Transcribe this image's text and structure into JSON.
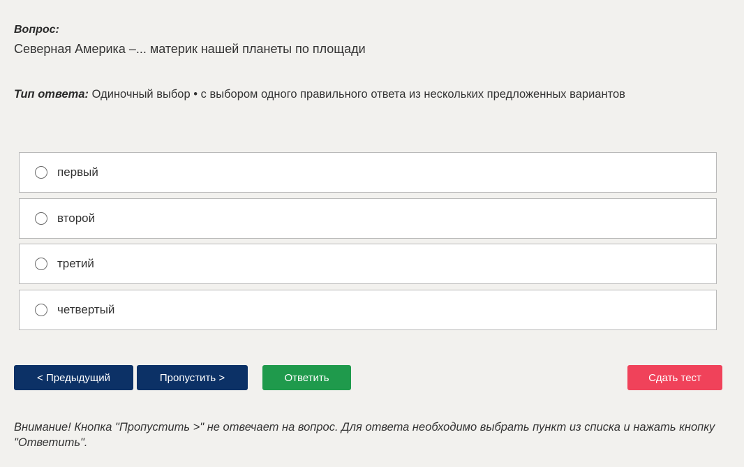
{
  "question": {
    "label": "Вопрос:",
    "text": "Северная Америка –... материк нашей планеты по площади"
  },
  "answer_type": {
    "label": "Тип ответа:",
    "value": "Одиночный выбор • с выбором одного правильного ответа из нескольких предложенных вариантов"
  },
  "options": [
    {
      "label": "первый",
      "selected": false
    },
    {
      "label": "второй",
      "selected": false
    },
    {
      "label": "третий",
      "selected": false
    },
    {
      "label": "четвертый",
      "selected": false
    }
  ],
  "buttons": {
    "prev": "< Предыдущий",
    "skip": "Пропустить >",
    "answer": "Ответить",
    "submit": "Сдать тест"
  },
  "colors": {
    "nav_button": "#0c3166",
    "answer_button": "#1f9a4c",
    "submit_button": "#f0425a",
    "background": "#f2f1ee"
  },
  "notice": "Внимание! Кнопка \"Пропустить >\" не отвечает на вопрос. Для ответа необходимо выбрать пункт из списка и нажать кнопку \"Ответить\"."
}
